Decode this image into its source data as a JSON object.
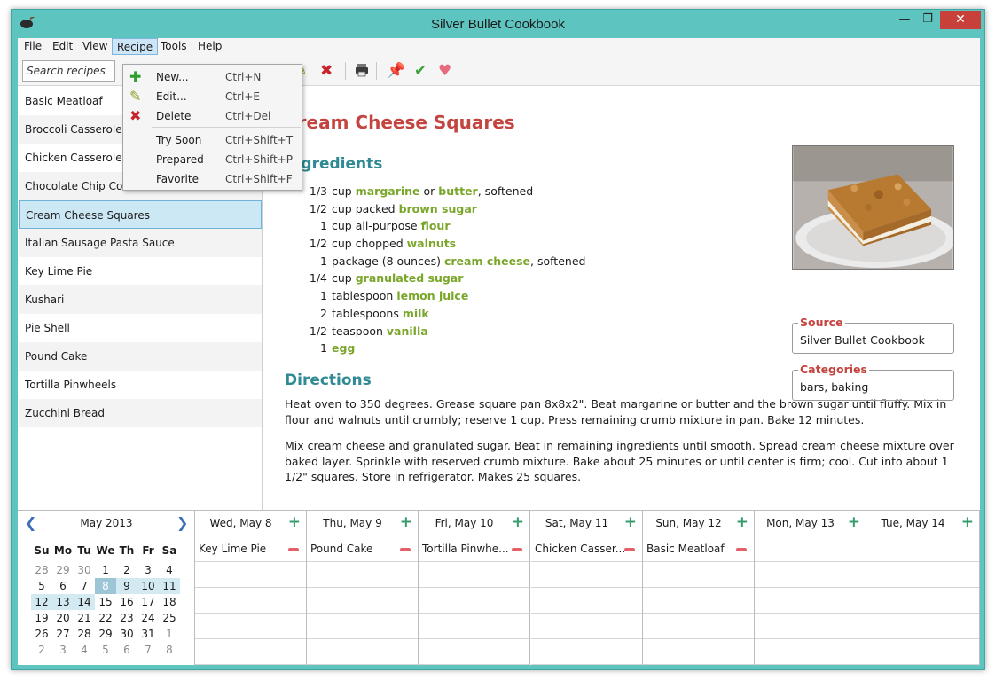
{
  "window": {
    "title": "Silver Bullet Cookbook",
    "minimize": "—",
    "maximize": "❐",
    "close": "✕"
  },
  "menubar": [
    "File",
    "Edit",
    "View",
    "Recipe",
    "Tools",
    "Help"
  ],
  "toolbar": {
    "search_placeholder": "Search recipes"
  },
  "recipe_menu": {
    "items": [
      {
        "label": "New...",
        "shortcut": "Ctrl+N",
        "icon": "plus-icon"
      },
      {
        "label": "Edit...",
        "shortcut": "Ctrl+E",
        "icon": "pencil-icon"
      },
      {
        "label": "Delete",
        "shortcut": "Ctrl+Del",
        "icon": "x-icon"
      },
      {
        "label": "Try Soon",
        "shortcut": "Ctrl+Shift+T"
      },
      {
        "label": "Prepared",
        "shortcut": "Ctrl+Shift+P"
      },
      {
        "label": "Favorite",
        "shortcut": "Ctrl+Shift+F"
      }
    ]
  },
  "recipes": [
    "Basic Meatloaf",
    "Broccoli Casserole",
    "Chicken Casserole",
    "Chocolate Chip Cookies",
    "Cream Cheese Squares",
    "Italian Sausage Pasta Sauce",
    "Key Lime Pie",
    "Kushari",
    "Pie Shell",
    "Pound Cake",
    "Tortilla Pinwheels",
    "Zucchini Bread"
  ],
  "selected_recipe": "Cream Cheese Squares",
  "detail": {
    "title": "Cream Cheese Squares",
    "ingredients_heading": "Ingredients",
    "ingredients": [
      {
        "qty": "1/3",
        "pre": "cup ",
        "food": "margarine",
        "mid": " or ",
        "food2": "butter",
        "post": ", softened"
      },
      {
        "qty": "1/2",
        "pre": "cup packed ",
        "food": "brown sugar",
        "mid": "",
        "food2": "",
        "post": ""
      },
      {
        "qty": "1",
        "pre": "cup all-purpose ",
        "food": "flour",
        "mid": "",
        "food2": "",
        "post": ""
      },
      {
        "qty": "1/2",
        "pre": "cup chopped ",
        "food": "walnuts",
        "mid": "",
        "food2": "",
        "post": ""
      },
      {
        "qty": "1",
        "pre": "package (8 ounces) ",
        "food": "cream cheese",
        "mid": "",
        "food2": "",
        "post": ", softened"
      },
      {
        "qty": "1/4",
        "pre": "cup ",
        "food": "granulated sugar",
        "mid": "",
        "food2": "",
        "post": ""
      },
      {
        "qty": "1",
        "pre": "tablespoon ",
        "food": "lemon juice",
        "mid": "",
        "food2": "",
        "post": ""
      },
      {
        "qty": "2",
        "pre": "tablespoons ",
        "food": "milk",
        "mid": "",
        "food2": "",
        "post": ""
      },
      {
        "qty": "1/2",
        "pre": "teaspoon ",
        "food": "vanilla",
        "mid": "",
        "food2": "",
        "post": ""
      },
      {
        "qty": "1",
        "pre": "",
        "food": "egg",
        "mid": "",
        "food2": "",
        "post": ""
      }
    ],
    "directions_heading": "Directions",
    "directions": [
      "Heat oven to 350 degrees. Grease square pan 8x8x2\". Beat margarine or butter and the brown sugar until fluffy. Mix in flour and walnuts until crumbly; reserve 1 cup. Press remaining crumb mixture in pan. Bake 12 minutes.",
      "Mix cream cheese and granulated sugar. Beat in remaining ingredients until smooth. Spread cream cheese mixture over baked layer. Sprinkle with reserved crumb mixture. Bake about 25 minutes or until center is firm; cool. Cut into about 1 1/2\" squares. Store in refrigerator. Makes 25 squares."
    ],
    "source_label": "Source",
    "source": "Silver Bullet Cookbook",
    "categories_label": "Categories",
    "categories": "bars, baking"
  },
  "calendar": {
    "month": "May 2013",
    "dow": [
      "Su",
      "Mo",
      "Tu",
      "We",
      "Th",
      "Fr",
      "Sa"
    ],
    "weeks": [
      [
        "28",
        "29",
        "30",
        "1",
        "2",
        "3",
        "4"
      ],
      [
        "5",
        "6",
        "7",
        "8",
        "9",
        "10",
        "11"
      ],
      [
        "12",
        "13",
        "14",
        "15",
        "16",
        "17",
        "18"
      ],
      [
        "19",
        "20",
        "21",
        "22",
        "23",
        "24",
        "25"
      ],
      [
        "26",
        "27",
        "28",
        "29",
        "30",
        "31",
        "1"
      ],
      [
        "2",
        "3",
        "4",
        "5",
        "6",
        "7",
        "8"
      ]
    ],
    "days": [
      {
        "label": "Wed, May 8",
        "recipe": "Key Lime Pie"
      },
      {
        "label": "Thu, May 9",
        "recipe": "Pound Cake"
      },
      {
        "label": "Fri, May 10",
        "recipe": "Tortilla Pinwhe..."
      },
      {
        "label": "Sat, May 11",
        "recipe": "Chicken Casser..."
      },
      {
        "label": "Sun, May 12",
        "recipe": "Basic Meatloaf"
      },
      {
        "label": "Mon, May 13",
        "recipe": ""
      },
      {
        "label": "Tue, May 14",
        "recipe": ""
      }
    ]
  }
}
